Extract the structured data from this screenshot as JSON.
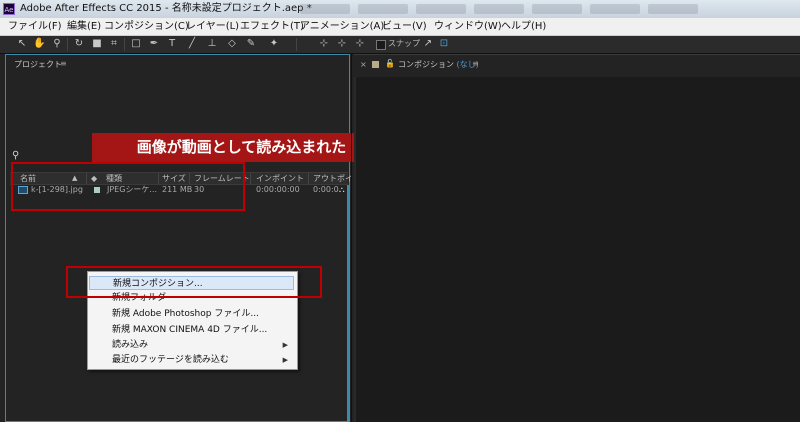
{
  "window": {
    "app_icon_text": "Ae",
    "title": "Adobe After Effects CC 2015 - 名称未設定プロジェクト.aep *"
  },
  "menubar": {
    "items": [
      "ファイル(F)",
      "編集(E)",
      "コンポジション(C)",
      "レイヤー(L)",
      "エフェクト(T)",
      "アニメーション(A)",
      "ビュー(V)",
      "ウィンドウ(W)",
      "ヘルプ(H)"
    ]
  },
  "toolbar": {
    "tools": [
      "selection-tool-icon",
      "hand-tool-icon",
      "zoom-tool-icon",
      "rotate-tool-icon",
      "camera-tool-icon",
      "pan-behind-tool-icon",
      "mask-tool-icon",
      "pen-tool-icon",
      "type-tool-icon",
      "brush-tool-icon",
      "clone-stamp-tool-icon",
      "eraser-tool-icon",
      "roto-brush-tool-icon",
      "puppet-tool-icon"
    ],
    "snap_label": "スナップ"
  },
  "project_panel": {
    "title": "プロジェクト",
    "menu_glyph": "≡",
    "search_glyph": "⚲",
    "columns": [
      "名前",
      "種類",
      "サイズ",
      "フレームレート",
      "インポイント",
      "アウトポイ"
    ],
    "rows": [
      {
        "name": "k-[1-298].jpg",
        "type": "JPEGシーケ...",
        "size": "211 MB",
        "frame_rate": "30",
        "in_point": "0:00:00:00",
        "out_point": "0:00:0"
      }
    ]
  },
  "callout": {
    "text": "画像が動画として読み込まれた",
    "color": "#a41616"
  },
  "context_menu": {
    "items": [
      {
        "label": "新規コンポジション...",
        "submenu": false,
        "highlighted": true
      },
      {
        "label": "新規フォルダー",
        "submenu": false,
        "highlighted": false
      },
      {
        "label": "新規 Adobe Photoshop ファイル...",
        "submenu": false,
        "highlighted": false
      },
      {
        "label": "新規 MAXON CINEMA 4D ファイル...",
        "submenu": false,
        "highlighted": false
      },
      {
        "label": "読み込み",
        "submenu": true,
        "highlighted": false
      },
      {
        "label": "最近のフッテージを読み込む",
        "submenu": true,
        "highlighted": false
      }
    ],
    "submenu_arrow": "▶"
  },
  "composition_panel": {
    "close_glyph": "×",
    "lock_glyph": "🔓",
    "title": "コンポジション",
    "title_value": "(なし)",
    "menu_glyph": "≡"
  },
  "colors": {
    "annotation_red": "#c00000",
    "panel_accent": "#3c89a8",
    "none_link": "#4aa0d8"
  }
}
